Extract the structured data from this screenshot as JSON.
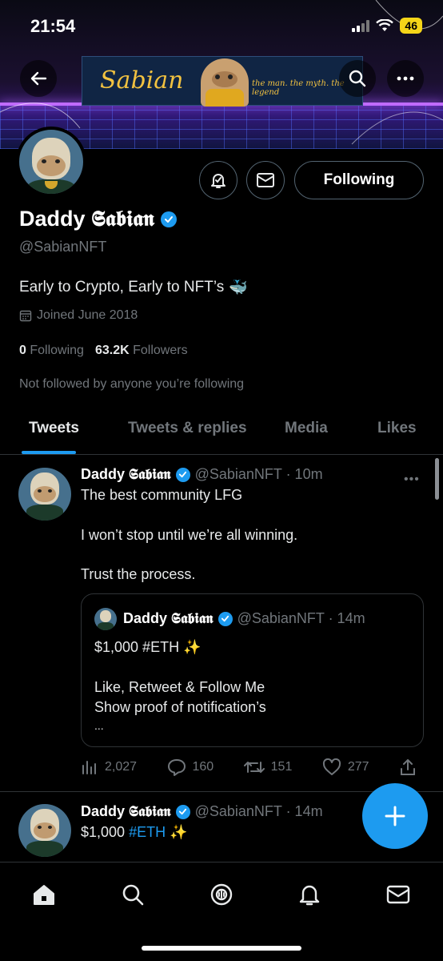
{
  "status_bar": {
    "time": "21:54",
    "battery": "46"
  },
  "banner": {
    "title": "Sabian",
    "tagline": "the man. the myth. the legend"
  },
  "profile": {
    "display_name": "Daddy 𝕾𝖆𝖇𝖎𝖆𝖓",
    "handle": "@SabianNFT",
    "bio": "Early to Crypto, Early to NFT’s",
    "bio_emoji": "🐳",
    "joined": "Joined June 2018",
    "following_count": "0",
    "following_label": "Following",
    "followers_count": "63.2K",
    "followers_label": "Followers",
    "not_followed": "Not followed by anyone you’re following",
    "follow_button": "Following"
  },
  "tabs": [
    {
      "label": "Tweets",
      "active": true
    },
    {
      "label": "Tweets & replies",
      "active": false
    },
    {
      "label": "Media",
      "active": false
    },
    {
      "label": "Likes",
      "active": false
    }
  ],
  "tweets": [
    {
      "name": "Daddy 𝕾𝖆𝖇𝖎𝖆𝖓",
      "meta": "@SabianNFT · 10m",
      "lines": [
        "The best community LFG",
        "I won’t stop until we’re all winning.",
        "Trust the process."
      ],
      "quote": {
        "name": "Daddy 𝕾𝖆𝖇𝖎𝖆𝖓",
        "meta": "@SabianNFT · 14m",
        "line1": "$1,000 #ETH ✨",
        "line2": "Like, Retweet & Follow Me",
        "line3": "Show proof of notification’s",
        "line4": "..."
      },
      "views": "2,027",
      "replies": "160",
      "retweets": "151",
      "likes": "277"
    },
    {
      "name": "Daddy 𝕾𝖆𝖇𝖎𝖆𝖓",
      "meta": "@SabianNFT · 14m",
      "text_prefix": "$1,000 ",
      "hashtag": "#ETH",
      "text_suffix": " ✨"
    }
  ],
  "colors": {
    "accent": "#1d9bf0",
    "background": "#000000",
    "muted": "#71767b",
    "border": "#2f3336"
  },
  "icons": [
    "back-arrow-icon",
    "search-icon",
    "more-icon",
    "notification-bell-icon",
    "mail-icon",
    "verified-badge-icon",
    "calendar-icon",
    "views-icon",
    "reply-icon",
    "retweet-icon",
    "like-icon",
    "share-icon",
    "compose-plus-icon",
    "home-icon",
    "explore-icon",
    "spaces-icon",
    "notifications-icon",
    "messages-icon"
  ]
}
